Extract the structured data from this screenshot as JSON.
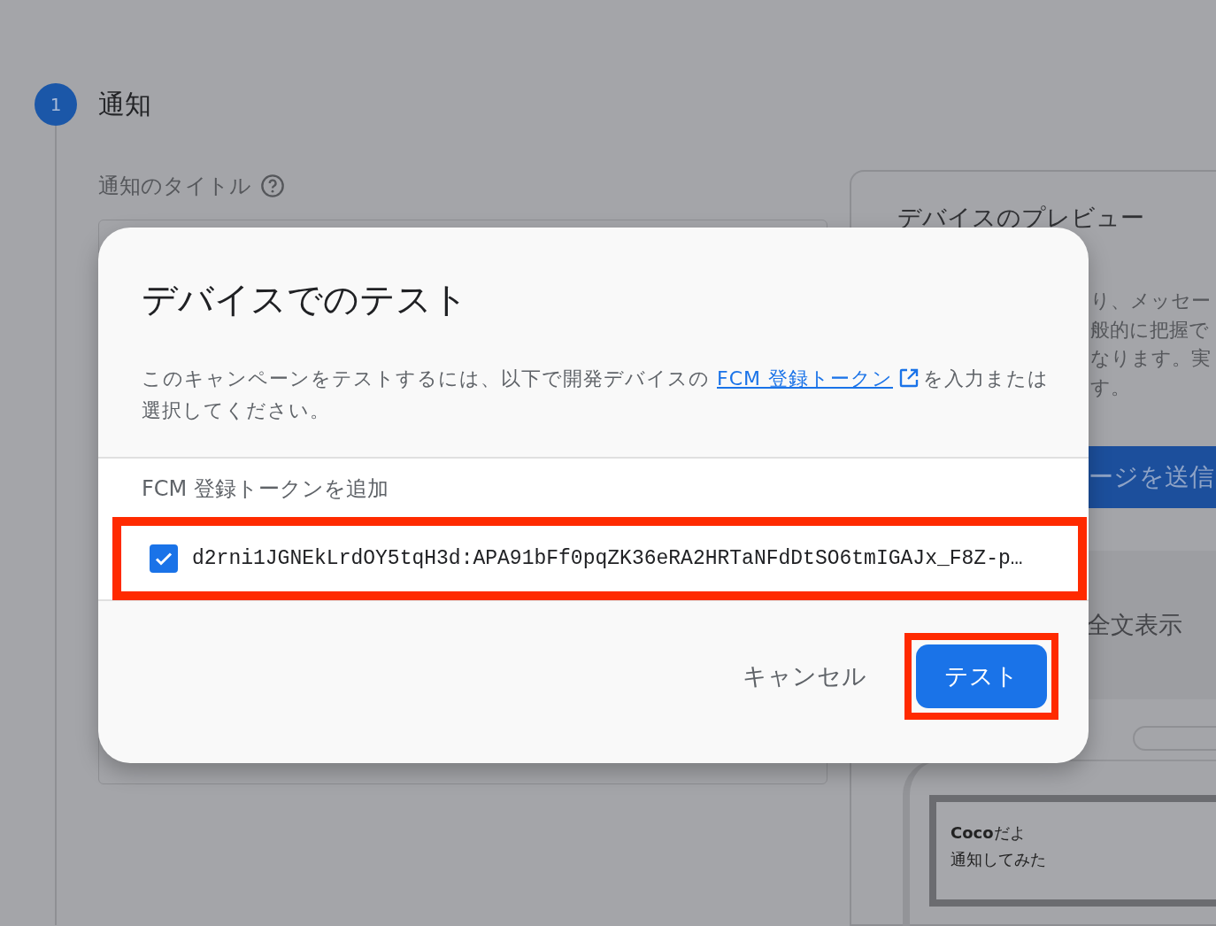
{
  "step": {
    "number": "1",
    "title": "通知",
    "field_label": "通知のタイトル"
  },
  "preview": {
    "title": "デバイスのプレビュー",
    "description_lines": [
      "り、メッセー",
      "般的に把握で",
      "なります。実",
      "す。"
    ],
    "send_button": "ージを送信",
    "full_text_label": "全文表示",
    "notification": {
      "title": "**Coco**だよ",
      "body": "通知してみた"
    }
  },
  "dialog": {
    "title": "デバイスでのテスト",
    "description": {
      "before": "このキャンペーンをテストするには、以下で開発デバイスの ",
      "link": "FCM 登録トークン",
      "after": "を入力または選択してください。"
    },
    "add_token_label": "FCM 登録トークンを追加",
    "tokens": [
      {
        "value": "d2rni1JGNEkLrdOY5tqH3d:APA91bFf0pqZK36eRA2HRTaNFdDtSO6tmIGAJx_F8Z-p…",
        "checked": true,
        "highlighted": true
      }
    ],
    "buttons": [
      {
        "label": "キャンセル",
        "kind": "text",
        "highlighted": false
      },
      {
        "label": "テスト",
        "kind": "primary",
        "highlighted": true
      }
    ]
  }
}
